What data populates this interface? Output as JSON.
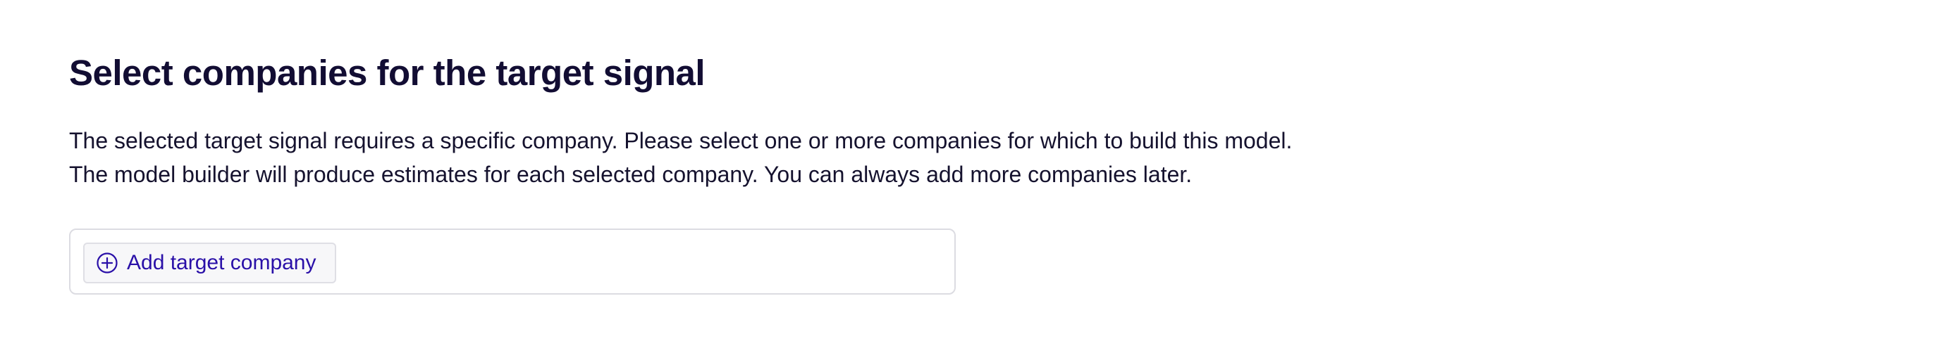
{
  "page": {
    "title": "Select companies for the target signal",
    "description_line1": "The selected target signal requires a specific company. Please select one or more companies for which to build this model.",
    "description_line2": "The model builder will produce estimates for each selected company. You can always add more companies later."
  },
  "picker": {
    "add_button_label": "Add target company",
    "add_button_icon": "plus-circle-icon"
  },
  "colors": {
    "heading": "#120d33",
    "text": "#15122e",
    "accent": "#2a10a8",
    "border": "#dcdce2",
    "button_bg": "#f7f7f9"
  }
}
